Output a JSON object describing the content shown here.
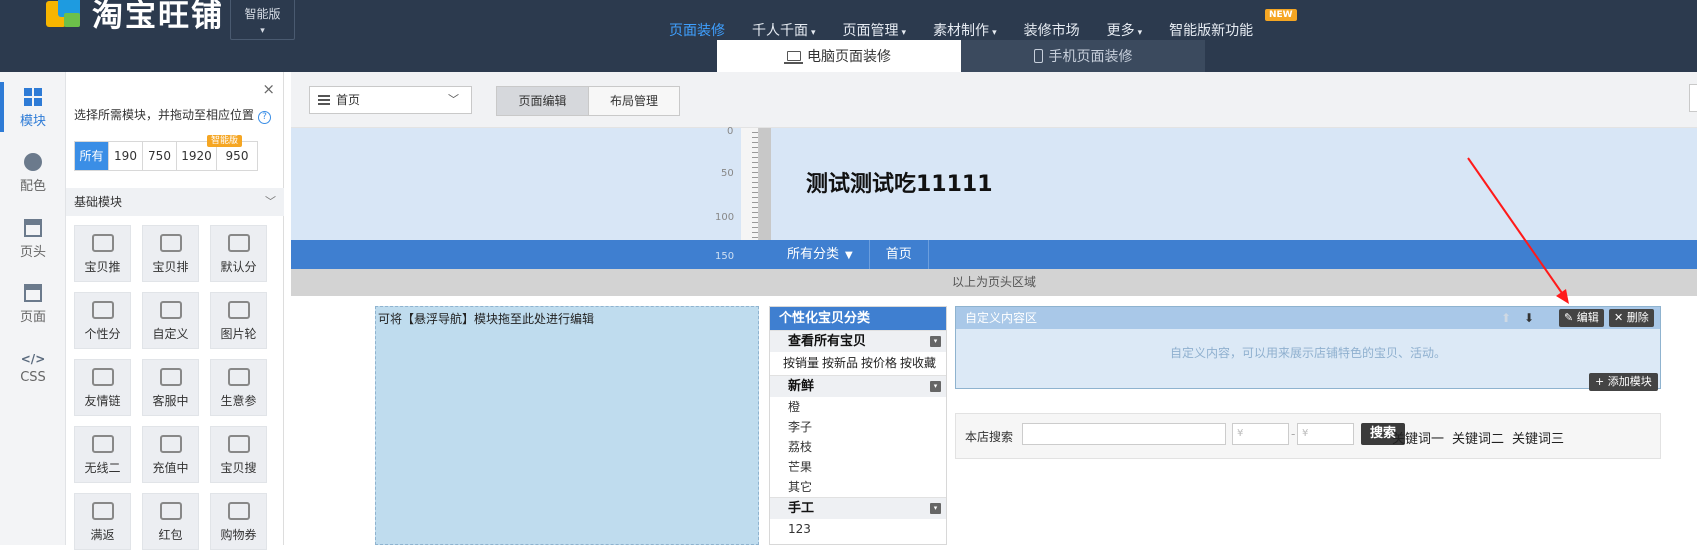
{
  "brand": {
    "logo_text": "淘宝旺铺",
    "edition": "智能版"
  },
  "nav": [
    {
      "label": "页面装修",
      "dropdown": false,
      "active": true
    },
    {
      "label": "千人千面",
      "dropdown": true
    },
    {
      "label": "页面管理",
      "dropdown": true
    },
    {
      "label": "素材制作",
      "dropdown": true
    },
    {
      "label": "装修市场",
      "dropdown": false
    },
    {
      "label": "更多",
      "dropdown": true
    },
    {
      "label": "智能版新功能",
      "dropdown": false
    }
  ],
  "nav_new_badge": "NEW",
  "device_tabs": {
    "pc": "电脑页面装修",
    "mobile": "手机页面装修"
  },
  "rail": [
    {
      "label": "模块",
      "icon": "grid-icon"
    },
    {
      "label": "配色",
      "icon": "palette-icon"
    },
    {
      "label": "页头",
      "icon": "header-icon"
    },
    {
      "label": "页面",
      "icon": "page-icon"
    },
    {
      "label": "CSS",
      "icon": "code-icon",
      "glyph": "</>"
    }
  ],
  "panel": {
    "close": "×",
    "hint": "选择所需模块，并拖动至相应位置",
    "help": "?",
    "filters": [
      "所有",
      "190",
      "750",
      "1920",
      "950"
    ],
    "smart_tag": "智能版",
    "section_title": "基础模块",
    "modules": [
      "宝贝推",
      "宝贝排",
      "默认分",
      "个性分",
      "自定义",
      "图片轮",
      "友情链",
      "客服中",
      "生意参",
      "无线二",
      "充值中",
      "宝贝搜",
      "满返",
      "红包",
      "购物券"
    ]
  },
  "toolbar": {
    "page_select": "首页",
    "edit_tab": "页面编辑",
    "layout_tab": "布局管理"
  },
  "canvas": {
    "ruler": [
      "0",
      "50",
      "100",
      "150"
    ],
    "shop_title": "测试测试吃11111",
    "band_nav": [
      "所有分类",
      "首页"
    ],
    "above_header": "以上为页头区域",
    "float_nav_hint": "可将【悬浮导航】模块拖至此处进行编辑",
    "category": {
      "title": "个性化宝贝分类",
      "all_items": "查看所有宝贝",
      "sorts": [
        "按销量",
        "按新品",
        "按价格",
        "按收藏"
      ],
      "group1": "新鲜",
      "group1_items": [
        "橙",
        "李子",
        "荔枝",
        "芒果",
        "其它"
      ],
      "group2": "手工",
      "group2_items": [
        "123"
      ]
    },
    "custom": {
      "title": "自定义内容区",
      "body": "自定义内容，可以用来展示店铺特色的宝贝、活动。",
      "edit": "编辑",
      "delete": "删除",
      "add": "添加模块"
    },
    "search": {
      "label": "本店搜索",
      "price_prefix": "¥",
      "dash": "-",
      "button": "搜索",
      "keywords": [
        "关键词一",
        "关键词二",
        "关键词三"
      ]
    }
  }
}
